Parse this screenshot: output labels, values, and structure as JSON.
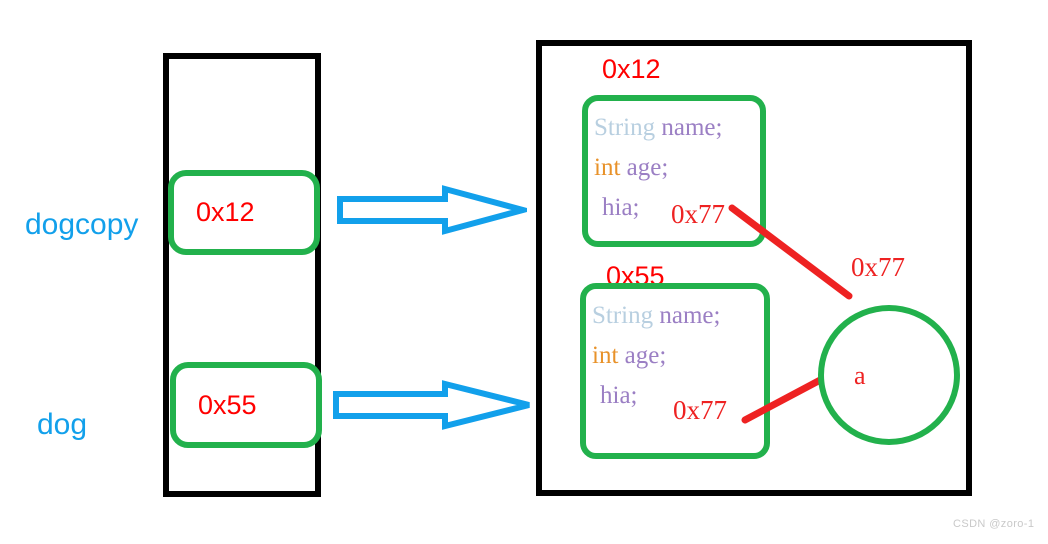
{
  "diagram": {
    "title": "Java reference / heap memory diagram",
    "colors": {
      "frame": "#000000",
      "reference_box": "#22b14c",
      "address_text": "#ff0000",
      "variable_label": "#12a0eb",
      "arrow": "#12a0eb",
      "connector": "#ee2222",
      "watermark": "#c9c9c9"
    }
  },
  "stack": {
    "variables": [
      {
        "name": "dogcopy",
        "address_value": "0x12"
      },
      {
        "name": "dog",
        "address_value": "0x55"
      }
    ]
  },
  "arrows": [
    {
      "from": "dogcopy",
      "to": "object-0x12",
      "icon": "block-arrow-right-icon"
    },
    {
      "from": "dog",
      "to": "object-0x55",
      "icon": "block-arrow-right-icon"
    }
  ],
  "heap": {
    "objects": [
      {
        "address": "0x12",
        "fields": [
          {
            "type": "String",
            "name": "name;"
          },
          {
            "type": "int",
            "name": "age;"
          },
          {
            "type": "",
            "name": "hia;"
          }
        ],
        "pointer_value": "0x77"
      },
      {
        "address": "0x55",
        "fields": [
          {
            "type": "String",
            "name": "name;"
          },
          {
            "type": "int",
            "name": "age;"
          },
          {
            "type": "",
            "name": "hia;"
          }
        ],
        "pointer_value": "0x77"
      }
    ],
    "shared_object": {
      "address_label": "0x77",
      "content": "a"
    }
  },
  "watermark": "CSDN @zoro-1"
}
